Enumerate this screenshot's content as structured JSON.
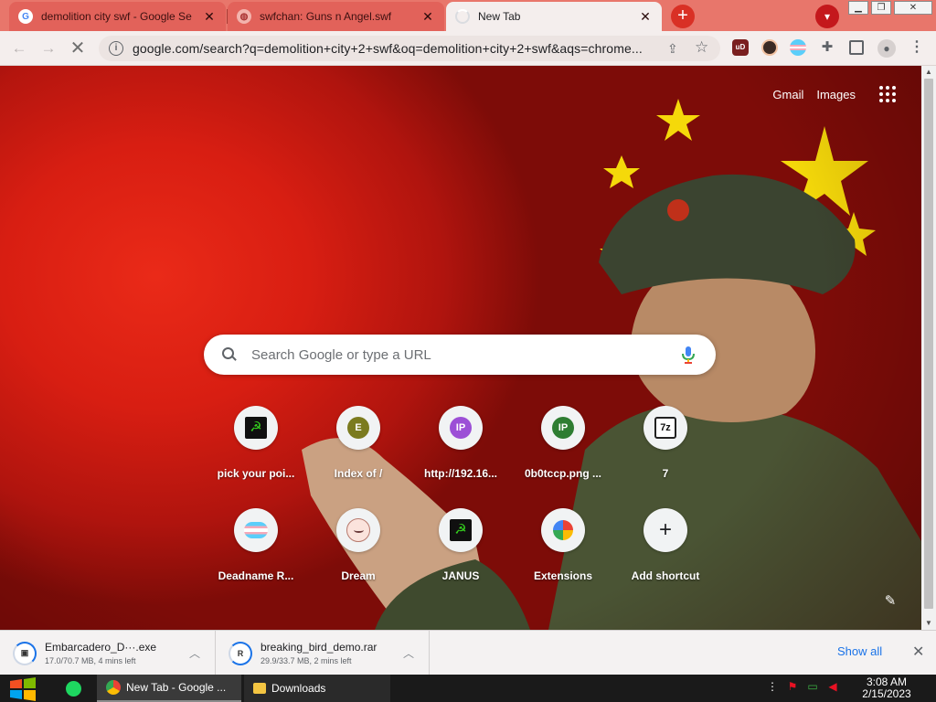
{
  "tabs": [
    {
      "title": "demolition city swf - Google Se",
      "favicon": "google-g-icon"
    },
    {
      "title": "swfchan: Guns n Angel.swf",
      "favicon": "globe-icon"
    },
    {
      "title": "New Tab",
      "favicon": "loading-icon"
    }
  ],
  "toolbar": {
    "url": "google.com/search?q=demolition+city+2+swf&oq=demolition+city+2+swf&aqs=chrome...",
    "url_ellipsis": "..."
  },
  "ntp": {
    "gmail_label": "Gmail",
    "images_label": "Images",
    "search_placeholder": "Search Google or type a URL",
    "shortcuts": [
      {
        "label": "pick your poi...",
        "icon": "hammer-sickle-icon"
      },
      {
        "label": "Index of /",
        "icon": "letter-e-icon",
        "letter": "E",
        "color": "#7b7b1f"
      },
      {
        "label": "http://192.16...",
        "icon": "ip-icon",
        "letter": "IP",
        "color": "#9c4fd6"
      },
      {
        "label": "0b0tccp.png ...",
        "icon": "ip-icon",
        "letter": "IP",
        "color": "#2e7d32"
      },
      {
        "label": "7",
        "icon": "7zip-icon",
        "letter": "7z"
      },
      {
        "label": "Deadname R...",
        "icon": "trans-flag-icon"
      },
      {
        "label": "Dream",
        "icon": "dream-face-icon"
      },
      {
        "label": "JANUS",
        "icon": "hammer-sickle-icon"
      },
      {
        "label": "Extensions",
        "icon": "extensions-rainbow-icon"
      },
      {
        "label": "Add shortcut",
        "icon": "plus-icon",
        "letter": "+"
      }
    ]
  },
  "downloads": {
    "items": [
      {
        "name": "Embarcadero_D···.exe",
        "status": "17.0/70.7 MB, 4 mins left"
      },
      {
        "name": "breaking_bird_demo.rar",
        "status": "29.9/33.7 MB, 2 mins left"
      }
    ],
    "show_all_label": "Show all"
  },
  "taskbar": {
    "chrome_label": "New Tab - Google ...",
    "downloads_label": "Downloads",
    "time": "3:08 AM",
    "date": "2/15/2023"
  },
  "colors": {
    "tabstrip": "#e8766b",
    "toolbar": "#f4eeed",
    "accent_blue": "#1a73e8",
    "taskbar": "#1a1a1a"
  }
}
